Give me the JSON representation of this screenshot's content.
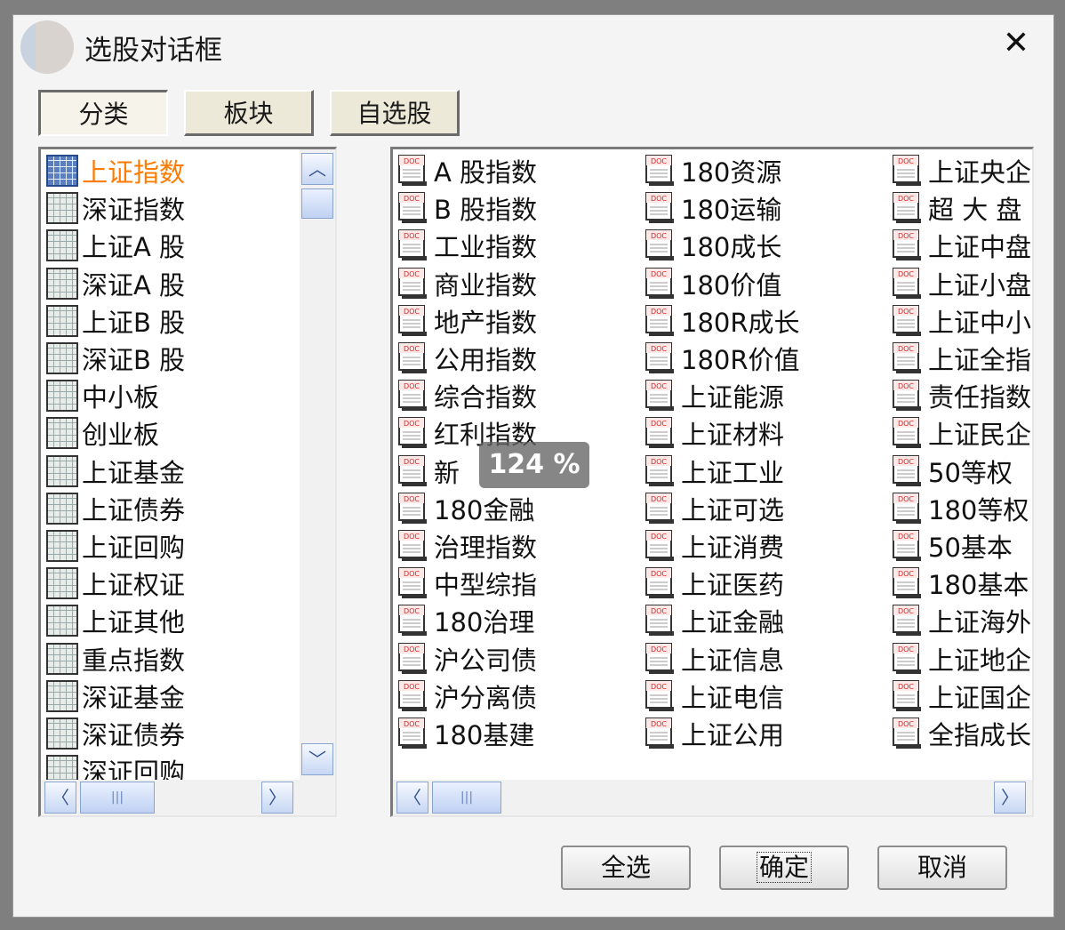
{
  "window": {
    "title": "选股对话框",
    "close_label": "✕"
  },
  "tabs": [
    {
      "label": "分类",
      "active": true
    },
    {
      "label": "板块",
      "active": false
    },
    {
      "label": "自选股",
      "active": false
    }
  ],
  "categories": [
    "上证指数",
    "深证指数",
    "上证A 股",
    "深证A 股",
    "上证B 股",
    "深证B 股",
    "中小板",
    "创业板",
    "上证基金",
    "上证债券",
    "上证回购",
    "上证权证",
    "上证其他",
    "重点指数",
    "深证基金",
    "深证债券",
    "深证回购"
  ],
  "selected_category_index": 0,
  "index_columns": [
    [
      "A 股指数",
      "B 股指数",
      "工业指数",
      "商业指数",
      "地产指数",
      "公用指数",
      "综合指数",
      "红利指数",
      "新",
      "180金融",
      "治理指数",
      "中型综指",
      "180治理",
      "沪公司债",
      "沪分离债",
      "180基建"
    ],
    [
      "180资源",
      "180运输",
      "180成长",
      "180价值",
      "180R成长",
      "180R价值",
      "上证能源",
      "上证材料",
      "上证工业",
      "上证可选",
      "上证消费",
      "上证医药",
      "上证金融",
      "上证信息",
      "上证电信",
      "上证公用"
    ],
    [
      "上证央企",
      "超 大 盘",
      "上证中盘",
      "上证小盘",
      "上证中小",
      "上证全指",
      "责任指数",
      "上证民企",
      "50等权",
      "180等权",
      "50基本",
      "180基本",
      "上证海外",
      "上证地企",
      "上证国企",
      "全指成长"
    ]
  ],
  "buttons": {
    "select_all": "全选",
    "ok": "确定",
    "cancel": "取消"
  },
  "zoom_overlay": "124 %",
  "scroll": {
    "up": "︿",
    "down": "﹀",
    "left": "〈",
    "right": "〉",
    "grip": "|||"
  },
  "icons": {
    "category": "grid-icon",
    "index_item": "doc-icon",
    "doc_text": "DOC"
  },
  "colors": {
    "selected_text": "#ff7a00",
    "scroll_accent": "#31508c"
  }
}
